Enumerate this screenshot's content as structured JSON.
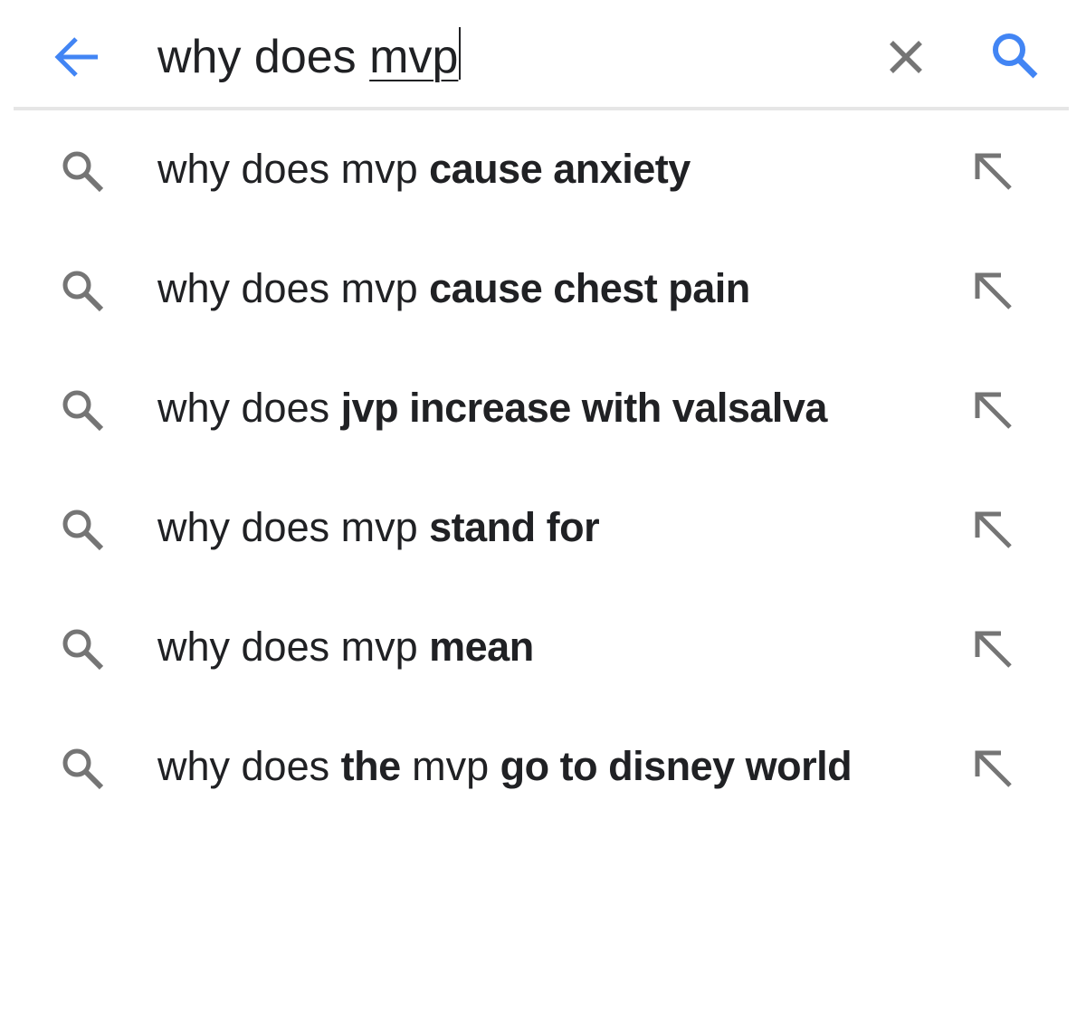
{
  "search_bar": {
    "query_prefix": "why does ",
    "query_composing": "mvp",
    "back_icon": "arrow-left-icon",
    "clear_icon": "close-icon",
    "search_icon": "search-icon",
    "accent_color": "#4285f4",
    "icon_color": "#757575"
  },
  "suggestions": [
    {
      "parts": [
        {
          "text": "why does mvp ",
          "bold": false
        },
        {
          "text": "cause anxiety",
          "bold": true
        }
      ]
    },
    {
      "parts": [
        {
          "text": "why does mvp ",
          "bold": false
        },
        {
          "text": "cause chest pain",
          "bold": true
        }
      ]
    },
    {
      "parts": [
        {
          "text": "why does ",
          "bold": false
        },
        {
          "text": "jvp increase with valsalva",
          "bold": true
        }
      ]
    },
    {
      "parts": [
        {
          "text": "why does mvp ",
          "bold": false
        },
        {
          "text": "stand for",
          "bold": true
        }
      ]
    },
    {
      "parts": [
        {
          "text": "why does mvp ",
          "bold": false
        },
        {
          "text": "mean",
          "bold": true
        }
      ]
    },
    {
      "parts": [
        {
          "text": "why does ",
          "bold": false
        },
        {
          "text": "the",
          "bold": true
        },
        {
          "text": " mvp ",
          "bold": false
        },
        {
          "text": "go to disney world",
          "bold": true
        }
      ]
    }
  ]
}
